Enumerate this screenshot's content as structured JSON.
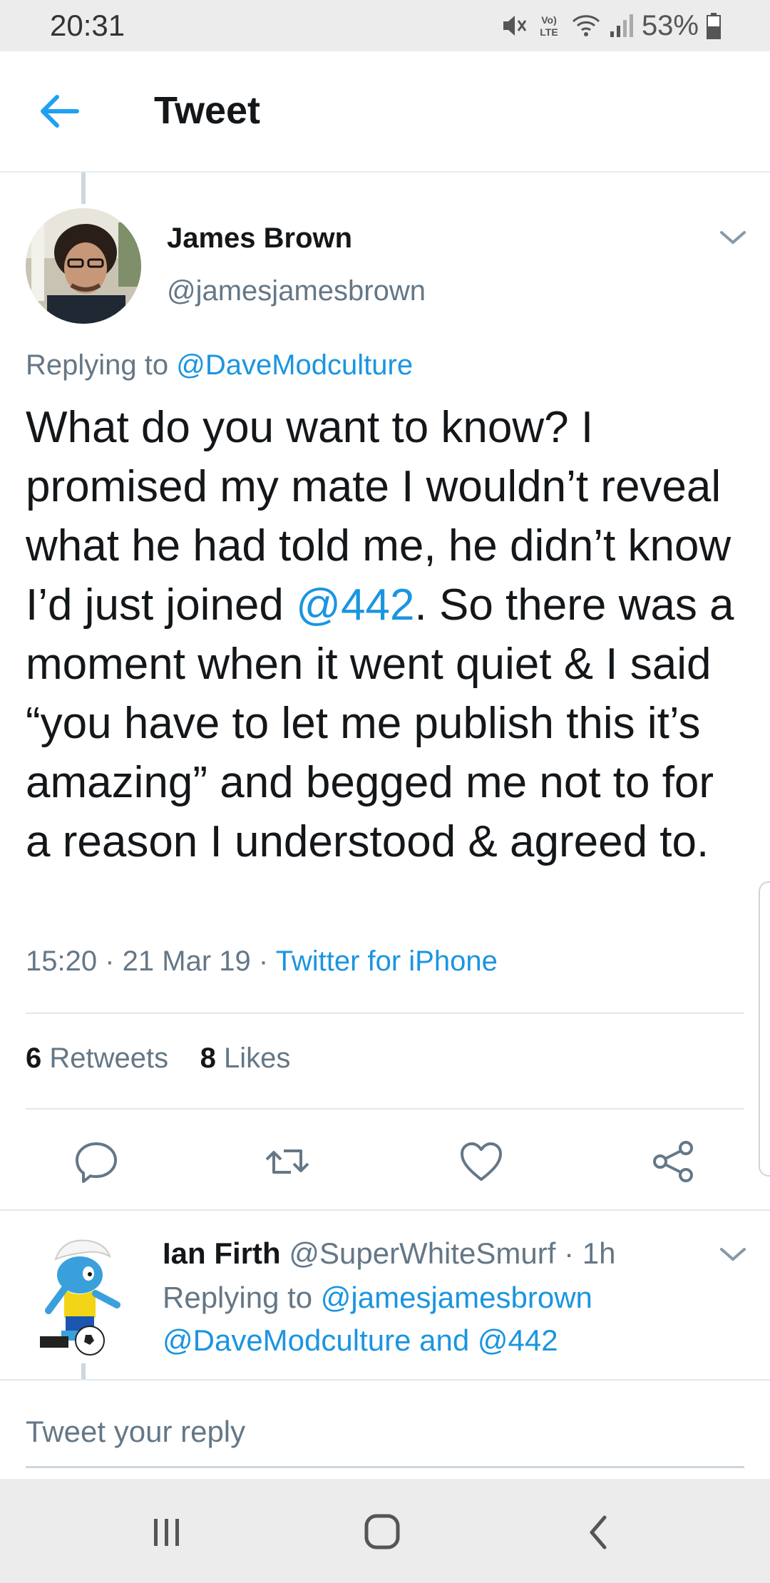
{
  "status_bar": {
    "time": "20:31",
    "battery": "53%",
    "icons": [
      "mute-icon",
      "volte-icon",
      "wifi-icon",
      "signal-icon",
      "battery-icon"
    ],
    "volte_label": "Vo) LTE"
  },
  "header": {
    "title": "Tweet"
  },
  "tweet": {
    "author_name": "James Brown",
    "author_handle": "@jamesjamesbrown",
    "replying_prefix": "Replying to",
    "replying_to": "@DaveModculture",
    "text_before": "What do you want to know? I promised my mate I wouldn’t reveal what he had told me, he didn’t know I’d just joined ",
    "text_mention": "@442",
    "text_after": ". So there was a moment when it went quiet & I said “you have to let me publish this it’s amazing” and begged me not to for a reason I understood & agreed to.",
    "time": "15:20",
    "date": "21 Mar 19",
    "source": "Twitter for iPhone",
    "retweets_count": "6",
    "retweets_label": "Retweets",
    "likes_count": "8",
    "likes_label": "Likes"
  },
  "reply": {
    "author_name": "Ian Firth",
    "author_handle": "@SuperWhiteSmurf",
    "age": "1h",
    "replying_prefix": "Replying to",
    "replying_to_1": "@jamesjamesbrown",
    "replying_to_2": "@DaveModculture",
    "joiner": "and",
    "replying_to_3": "@442"
  },
  "compose": {
    "placeholder": "Tweet your reply"
  },
  "colors": {
    "accent": "#1b95e0",
    "secondary_text": "#657786",
    "primary_text": "#14171a"
  }
}
